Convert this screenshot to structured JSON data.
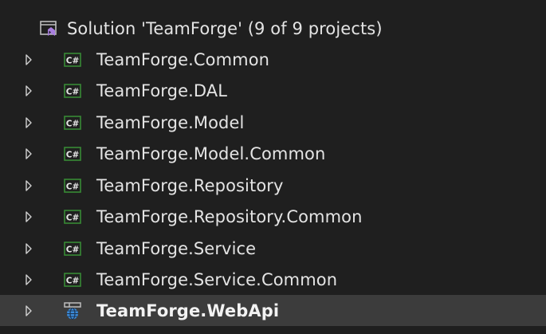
{
  "solution": {
    "label": "Solution 'TeamForge' (9 of 9 projects)",
    "icon": "solution-icon"
  },
  "projects": [
    {
      "label": "TeamForge.Common",
      "icon": "csharp-project-icon"
    },
    {
      "label": "TeamForge.DAL",
      "icon": "csharp-project-icon"
    },
    {
      "label": "TeamForge.Model",
      "icon": "csharp-project-icon"
    },
    {
      "label": "TeamForge.Model.Common",
      "icon": "csharp-project-icon"
    },
    {
      "label": "TeamForge.Repository",
      "icon": "csharp-project-icon"
    },
    {
      "label": "TeamForge.Repository.Common",
      "icon": "csharp-project-icon"
    },
    {
      "label": "TeamForge.Service",
      "icon": "csharp-project-icon"
    },
    {
      "label": "TeamForge.Service.Common",
      "icon": "csharp-project-icon"
    },
    {
      "label": "TeamForge.WebApi",
      "icon": "web-project-icon",
      "selected": true
    }
  ],
  "colors": {
    "background": "#1f1f1f",
    "selected_row": "#3c3c3c",
    "csharp_badge": "#388a34",
    "web_icon": "#3c8fe0",
    "solution_accent": "#a97fe0"
  }
}
